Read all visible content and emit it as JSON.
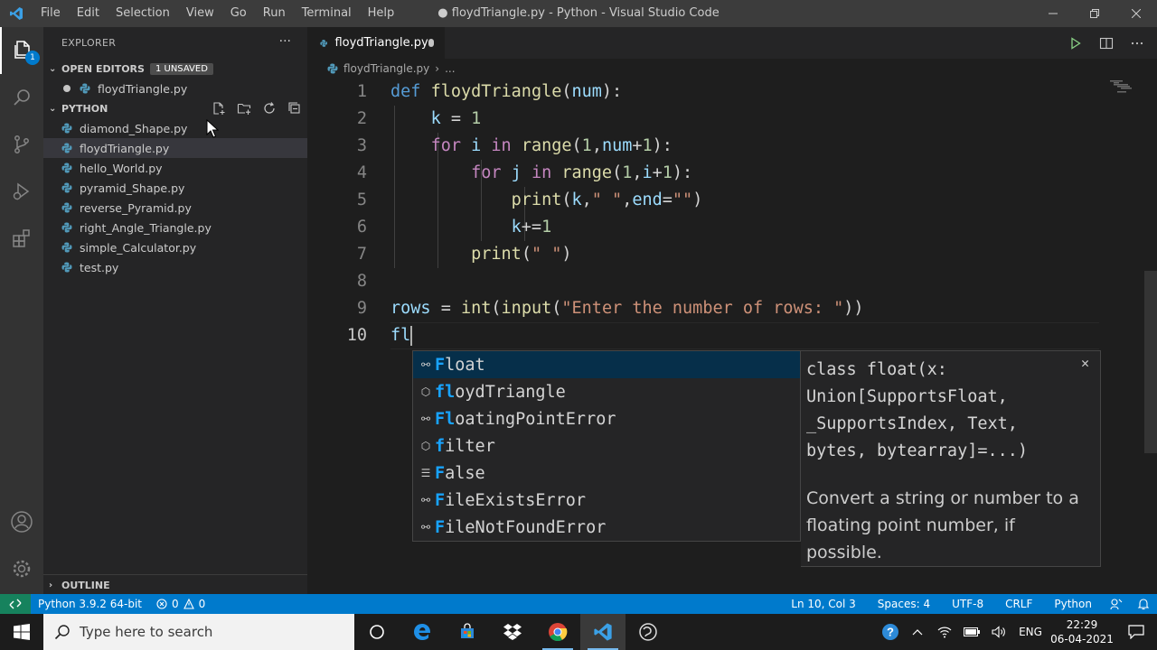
{
  "window": {
    "title": "● floydTriangle.py - Python - Visual Studio Code"
  },
  "menu": [
    "File",
    "Edit",
    "Selection",
    "View",
    "Go",
    "Run",
    "Terminal",
    "Help"
  ],
  "activity_badge": "1",
  "sidebar": {
    "title": "EXPLORER",
    "open_editors": {
      "label": "OPEN EDITORS",
      "badge": "1 UNSAVED",
      "files": [
        "floydTriangle.py"
      ]
    },
    "folder": {
      "label": "PYTHON",
      "files": [
        "diamond_Shape.py",
        "floydTriangle.py",
        "hello_World.py",
        "pyramid_Shape.py",
        "reverse_Pyramid.py",
        "right_Angle_Triangle.py",
        "simple_Calculator.py",
        "test.py"
      ]
    },
    "outline": "OUTLINE"
  },
  "editor": {
    "tab": "floydTriangle.py",
    "breadcrumb": {
      "file": "floydTriangle.py",
      "more": "..."
    },
    "line_numbers": [
      "1",
      "2",
      "3",
      "4",
      "5",
      "6",
      "7",
      "8",
      "9",
      "10"
    ],
    "current_line_text": "fl"
  },
  "suggest": {
    "items": [
      {
        "match": "F",
        "rest": "loat",
        "full": "float",
        "kind": "class"
      },
      {
        "match": "fl",
        "rest": "oydTriangle",
        "full": "floydTriangle",
        "kind": "function"
      },
      {
        "match": "Fl",
        "rest": "oatingPointError",
        "full": "FloatingPointError",
        "kind": "class"
      },
      {
        "match": "f",
        "rest": "ilter",
        "full": "filter",
        "kind": "function"
      },
      {
        "match": "F",
        "rest": "alse",
        "full": "False",
        "kind": "keyword"
      },
      {
        "match": "F",
        "rest": "ileExistsError",
        "full": "FileExistsError",
        "kind": "class"
      },
      {
        "match": "F",
        "rest": "ileNotFoundError",
        "full": "FileNotFoundError",
        "kind": "class"
      }
    ],
    "signature": "class float(x: Union[SupportsFloat, _SupportsIndex, Text, bytes, bytearray]=...)",
    "doc": "Convert a string or number to a floating point number, if possible."
  },
  "status": {
    "interpreter": "Python 3.9.2 64-bit",
    "errors": "0",
    "warnings": "0",
    "position": "Ln 10, Col 3",
    "spaces": "Spaces: 4",
    "encoding": "UTF-8",
    "eol": "CRLF",
    "language": "Python"
  },
  "taskbar": {
    "search_placeholder": "Type here to search",
    "lang": "ENG",
    "time": "22:29",
    "date": "06-04-2021"
  },
  "colors": {
    "accent": "#007acc",
    "remote": "#16825d",
    "highlight": "#18a3ff",
    "python_icon": "#519aba"
  }
}
